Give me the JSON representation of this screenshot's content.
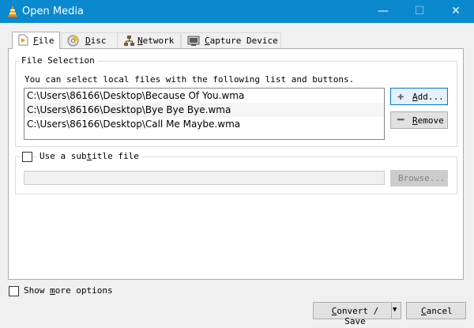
{
  "window": {
    "title": "Open Media",
    "minimize_glyph": "—",
    "maximize_glyph": "☐",
    "close_glyph": "✕"
  },
  "tabs": [
    {
      "pre": "",
      "key": "F",
      "post": "ile",
      "icon": "file-icon"
    },
    {
      "pre": "",
      "key": "D",
      "post": "isc",
      "icon": "disc-icon"
    },
    {
      "pre": "",
      "key": "N",
      "post": "etwork",
      "icon": "network-icon"
    },
    {
      "pre": "",
      "key": "C",
      "post": "apture Device",
      "icon": "capture-device-icon"
    }
  ],
  "file_selection": {
    "legend": "File Selection",
    "hint": "You can select local files with the following list and buttons.",
    "files": [
      "C:\\Users\\86166\\Desktop\\Because Of You.wma",
      "C:\\Users\\86166\\Desktop\\Bye Bye Bye.wma",
      "C:\\Users\\86166\\Desktop\\Call Me Maybe.wma"
    ],
    "add": {
      "pre": "",
      "key": "A",
      "post": "dd..."
    },
    "remove": {
      "pre": "",
      "key": "R",
      "post": "emove"
    }
  },
  "subtitle": {
    "pre": "Use a sub",
    "key": "t",
    "post": "itle file",
    "browse_label": "Browse...",
    "checked": false
  },
  "show_more": {
    "pre": "Show ",
    "key": "m",
    "post": "ore options",
    "checked": false
  },
  "actions": {
    "convert": {
      "pre": "",
      "key": "C",
      "post": "onvert / Save"
    },
    "cancel": {
      "pre": "",
      "key": "C",
      "post": "ancel"
    }
  },
  "colors": {
    "titlebar": "#0a89cf",
    "accent_border": "#0078d7"
  }
}
